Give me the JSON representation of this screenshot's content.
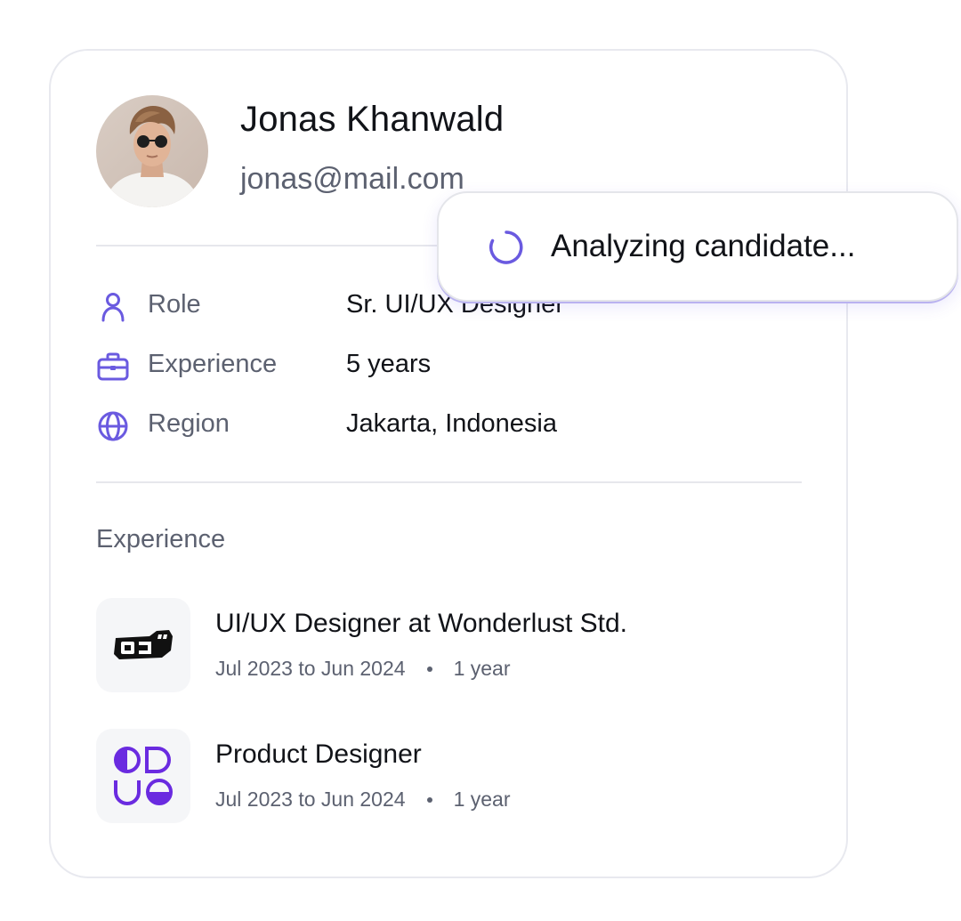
{
  "profile": {
    "name": "Jonas Khanwald",
    "email": "jonas@mail.com"
  },
  "details": [
    {
      "icon": "user-icon",
      "label": "Role",
      "value": "Sr. UI/UX Designer"
    },
    {
      "icon": "briefcase-icon",
      "label": "Experience",
      "value": "5 years"
    },
    {
      "icon": "globe-icon",
      "label": "Region",
      "value": "Jakarta, Indonesia"
    }
  ],
  "experience": {
    "heading": "Experience",
    "items": [
      {
        "logo": "wonderlust-logo",
        "title": "UI/UX Designer at Wonderlust Std.",
        "period": "Jul 2023 to Jun 2024",
        "duration": "1 year"
      },
      {
        "logo": "shapes-logo",
        "title": "Product Designer",
        "period": "Jul 2023 to Jun 2024",
        "duration": "1 year"
      }
    ]
  },
  "status": {
    "icon": "spinner-icon",
    "text": "Analyzing candidate..."
  },
  "colors": {
    "accent": "#6a5ae0",
    "logo_purple": "#6a2be0",
    "muted_text": "#5c6170",
    "divider": "#e6e7ec"
  }
}
